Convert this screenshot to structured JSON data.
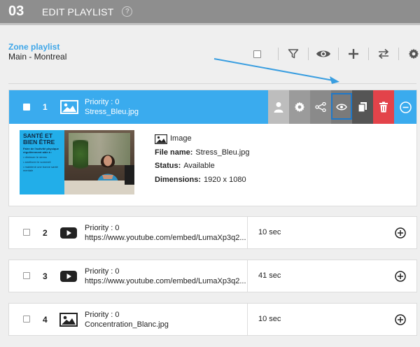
{
  "header": {
    "step_number": "03",
    "title": "EDIT PLAYLIST",
    "help_symbol": "?"
  },
  "zone": {
    "label": "Zone playlist",
    "name": "Main - Montreal"
  },
  "toolbar": {
    "icons": [
      "select-all-checkbox",
      "filter-icon",
      "eye-icon",
      "plus-icon",
      "swap-icon",
      "gear-icon"
    ]
  },
  "selected_item": {
    "index": "1",
    "priority": "Priority : 0",
    "filename": "Stress_Bleu.jpg",
    "actions": [
      "user-icon",
      "gear-icon",
      "share-icon",
      "eye-icon",
      "copy-icon",
      "trash-icon",
      "minus-circle-icon"
    ],
    "highlighted_action": "eye-icon",
    "details": {
      "type": "Image",
      "file_name_label": "File name:",
      "file_name": "Stress_Bleu.jpg",
      "status_label": "Status:",
      "status": "Available",
      "dimensions_label": "Dimensions:",
      "dimensions": "1920 x 1080"
    },
    "thumbnail": {
      "title_line1": "SANTÉ ET",
      "title_line2": "BIEN ÊTRE",
      "subtitle": "Faire de l'activité physique régulièrement aide à :",
      "bullet1": "• diminuer le stress",
      "bullet2": "• améliorer le sommeil",
      "bullet3": "• maintenir une bonne santé mentale"
    }
  },
  "items": [
    {
      "index": "2",
      "type": "youtube",
      "priority": "Priority : 0",
      "source": "https://www.youtube.com/embed/LumaXp3q2...",
      "duration": "10 sec"
    },
    {
      "index": "3",
      "type": "youtube",
      "priority": "Priority : 0",
      "source": "https://www.youtube.com/embed/LumaXp3q2...",
      "duration": "41 sec"
    },
    {
      "index": "4",
      "type": "image",
      "priority": "Priority : 0",
      "source": "Concentration_Blanc.jpg",
      "duration": "10 sec"
    }
  ],
  "colors": {
    "accent": "#3aabee",
    "header_bg": "#8e8e8e",
    "delete": "#e3434a",
    "annotation_arrow": "#3a9ee0"
  }
}
